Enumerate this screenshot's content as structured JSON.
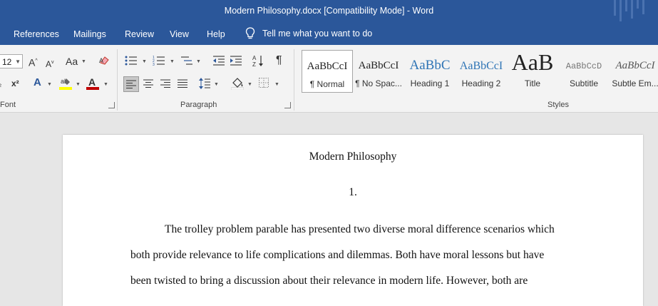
{
  "window": {
    "title": "Modern Philosophy.docx [Compatibility Mode]  -  Word"
  },
  "tabs": [
    {
      "label": "References"
    },
    {
      "label": "Mailings"
    },
    {
      "label": "Review"
    },
    {
      "label": "View"
    },
    {
      "label": "Help"
    }
  ],
  "tellme": {
    "text": "Tell me what you want to do"
  },
  "font": {
    "size_value": "12",
    "group_label": "Font",
    "grow_label": "A",
    "shrink_label": "A",
    "case_label": "Aa",
    "subscript_label": "x",
    "superscript_label": "x²",
    "font_color_label": "A"
  },
  "paragraph": {
    "group_label": "Paragraph",
    "pilcrow_label": "¶"
  },
  "styles": {
    "group_label": "Styles",
    "items": [
      {
        "sample": "AaBbCcI",
        "name": "¶ Normal"
      },
      {
        "sample": "AaBbCcI",
        "name": "¶ No Spac..."
      },
      {
        "sample": "AaBbC",
        "name": "Heading 1"
      },
      {
        "sample": "AaBbCcI",
        "name": "Heading 2"
      },
      {
        "sample": "AaB",
        "name": "Title"
      },
      {
        "sample": "AaBbCcD",
        "name": "Subtitle"
      },
      {
        "sample": "AaBbCcI",
        "name": "Subtle Em..."
      }
    ]
  },
  "document": {
    "title": "Modern Philosophy",
    "number": "1.",
    "lines": [
      "The trolley problem parable has presented two diverse moral difference scenarios which",
      "both provide relevance to life complications and dilemmas. Both have moral lessons but have",
      "been twisted to bring a discussion about their relevance in modern life. However, both are"
    ]
  },
  "colors": {
    "word_blue": "#2b579a",
    "ribbon_bg": "#f3f3f3",
    "canvas_bg": "#e6e6e6",
    "heading_blue": "#2e74b5",
    "highlight_yellow": "#ffff00",
    "font_red": "#c00000"
  }
}
